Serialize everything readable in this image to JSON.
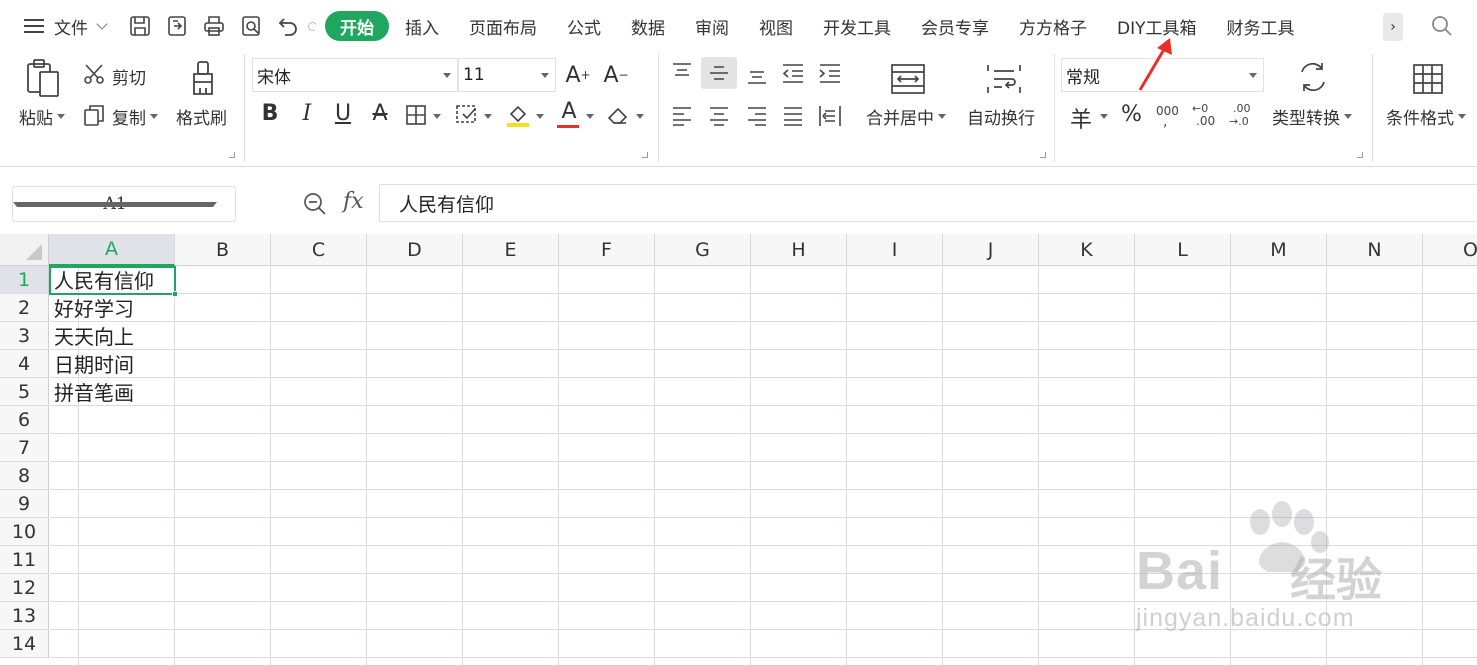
{
  "menubar": {
    "file_label": "文件",
    "tabs": [
      "开始",
      "插入",
      "页面布局",
      "公式",
      "数据",
      "审阅",
      "视图",
      "开发工具",
      "会员专享",
      "方方格子",
      "DIY工具箱",
      "财务工具"
    ],
    "active_tab": "开始",
    "more_label": "›"
  },
  "ribbon": {
    "paste_label": "粘贴",
    "cut_label": "剪切",
    "copy_label": "复制",
    "format_painter_label": "格式刷",
    "font_name": "宋体",
    "font_size": "11",
    "merge_center_label": "合并居中",
    "wrap_text_label": "自动换行",
    "number_format": "常规",
    "currency_symbol": "羊",
    "percent_symbol": "%",
    "type_convert_label": "类型转换",
    "conditional_format_label": "条件格式"
  },
  "formula_bar": {
    "name_box": "A1",
    "fx_label": "fx",
    "formula": "人民有信仰"
  },
  "sheet": {
    "columns": [
      "A",
      "B",
      "C",
      "D",
      "E",
      "F",
      "G",
      "H",
      "I",
      "J",
      "K",
      "L",
      "M",
      "N",
      "O"
    ],
    "rows": [
      "1",
      "2",
      "3",
      "4",
      "5",
      "6",
      "7",
      "8",
      "9",
      "10",
      "11",
      "12",
      "13",
      "14"
    ],
    "selected_cell": "A1",
    "cells_A": [
      "人民有信仰",
      "好好学习",
      "天天向上",
      "日期时间",
      "拼音笔画"
    ]
  },
  "watermark": {
    "brand": "Bai",
    "brand_cn": "经验",
    "url": "jingyan.baidu.com"
  },
  "colors": {
    "accent_green": "#1fa75f",
    "annotation_red": "#e8302a"
  }
}
